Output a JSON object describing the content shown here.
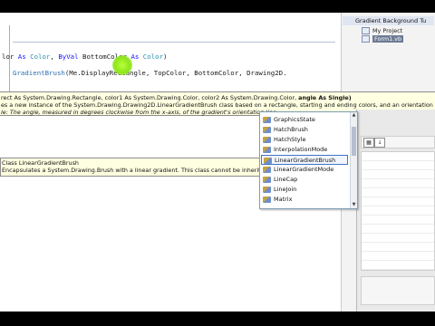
{
  "code": {
    "line1": {
      "k1": "lor",
      "k2": " As ",
      "k3": "Color",
      "p1": ", ",
      "k4": "ByVal",
      "p2": " BottomColor ",
      "k5": "As",
      "p3": " ",
      "k6": "Color",
      "p4": ")"
    },
    "line2": {
      "cls": "GradientBrush",
      "args": "(Me.DisplayRectangle, TopColor, BottomColor, Drawing2D."
    }
  },
  "signature_tip": {
    "line1_prefix": "rect As System.Drawing.Rectangle, color1 As System.Drawing.Color, color2 As System.Drawing.Color, ",
    "line1_bold": "angle As Single)",
    "line2": "es a new instance of the System.Drawing.Drawing2D.LinearGradientBrush class based on a rectangle, starting and ending colors, and an orientation angle.",
    "line3": "le: The angle, measured in degrees clockwise from the x-axis, of the gradient's orientation line."
  },
  "class_tip": {
    "line1": "Class LinearGradientBrush",
    "line2": "Encapsulates a System.Drawing.Brush with a linear gradient. This class cannot be inherited."
  },
  "completion_list": {
    "items": [
      "GraphicsState",
      "HatchBrush",
      "HatchStyle",
      "InterpolationMode",
      "LinearGradientBrush",
      "LinearGradientMode",
      "LineCap",
      "LineJoin",
      "Matrix"
    ],
    "selected_index": 4
  },
  "solution_explorer": {
    "title": "Gradient Background Tu",
    "items": [
      "My Project",
      "Form1.vb"
    ]
  },
  "colors": {
    "keyword": "#1515ff",
    "type": "#2b91af",
    "tooltip_bg": "#ffffe1",
    "selection_border": "#3e74c9",
    "cursor_highlight": "#9cf21f"
  }
}
